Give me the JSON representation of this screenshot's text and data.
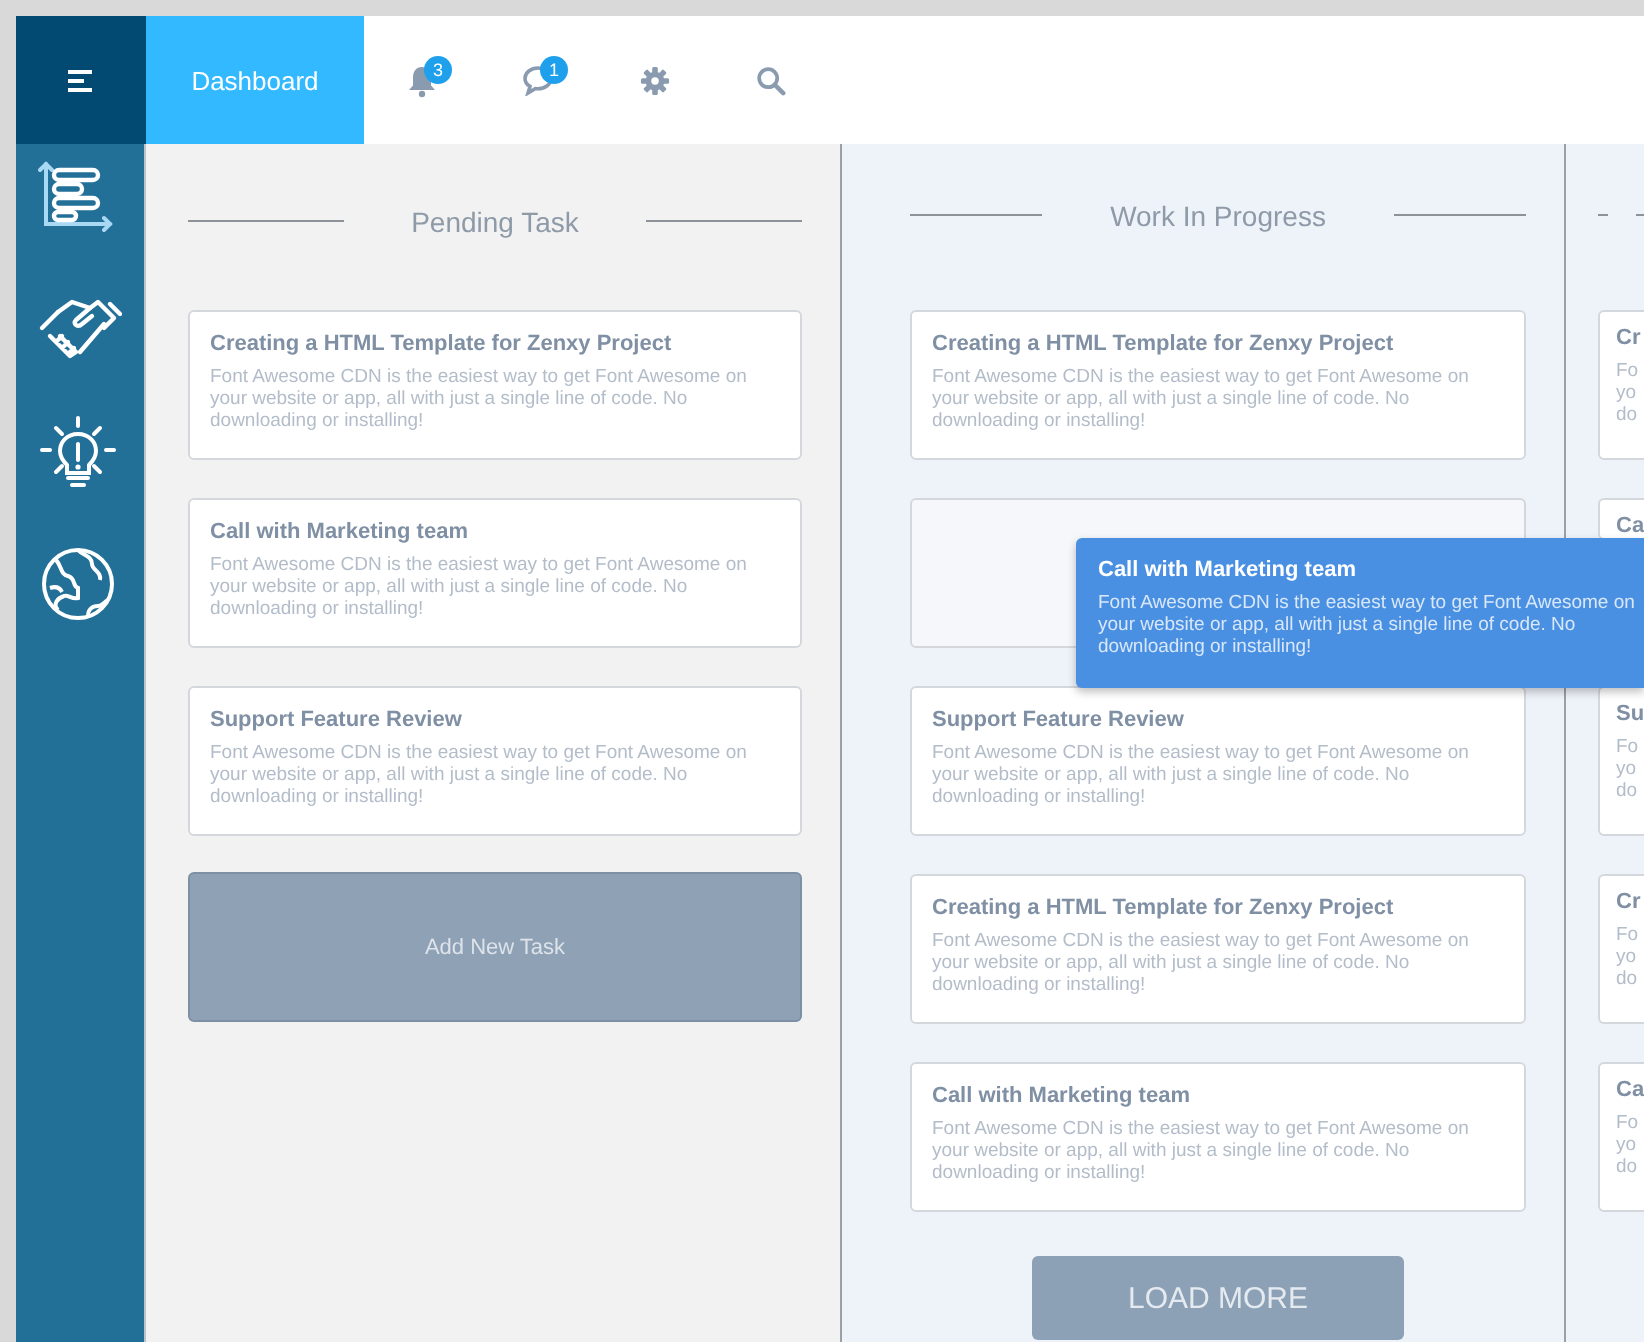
{
  "tabs": [
    {
      "label": "Dashboard",
      "selected": true
    }
  ],
  "toolbar": [
    {
      "kind": "bell",
      "badge": "3"
    },
    {
      "kind": "chat",
      "badge": "1"
    },
    {
      "kind": "gear"
    },
    {
      "kind": "search"
    }
  ],
  "sidebar": {
    "items": [
      {
        "kind": "chart"
      },
      {
        "kind": "handshake"
      },
      {
        "kind": "idea"
      },
      {
        "kind": "globe"
      }
    ]
  },
  "columns": [
    {
      "title": "Pending Task",
      "cards": [
        {
          "title": "Creating a HTML Template for Zenxy Project",
          "text": "Font Awesome CDN is the easiest way to get Font Awesome on your website or app, all with just a single line of code. No downloading or installing!"
        },
        {
          "title": "Call with Marketing team",
          "text": "Font Awesome CDN is the easiest way to get Font Awesome on your website or app, all with just a single line of code. No downloading or installing!"
        },
        {
          "title": "Support Feature Review",
          "text": "Font Awesome CDN is the easiest way to get Font Awesome on your website or app, all with just a single line of code. No downloading or installing!"
        }
      ],
      "button": {
        "kind": "add",
        "label": "Add New Task"
      }
    },
    {
      "title": "Work In Progress",
      "cards": [
        {
          "title": "Creating a HTML Template for Zenxy Project",
          "text": "Font Awesome CDN is the easiest way to get Font Awesome on your website or app, all with just a single line of code. No downloading or installing!"
        },
        {
          "kind": "placeholder"
        },
        {
          "title": "Support Feature Review",
          "text": "Font Awesome CDN is the easiest way to get Font Awesome on your website or app, all with just a single line of code. No downloading or installing!"
        },
        {
          "title": "Creating a HTML Template for Zenxy Project",
          "text": "Font Awesome CDN is the easiest way to get Font Awesome on your website or app, all with just a single line of code. No downloading or installing!"
        },
        {
          "title": "Call with Marketing team",
          "text": "Font Awesome CDN is the easiest way to get Font Awesome on your website or app, all with just a single line of code. No downloading or installing!"
        }
      ],
      "button": {
        "kind": "load",
        "label": "LOAD MORE"
      }
    },
    {
      "cards": [
        {
          "title": "Cr",
          "text_lines": [
            "Fo",
            "yo",
            "do"
          ]
        },
        {
          "title": "Ca"
        },
        {
          "title": "Su",
          "text_lines": [
            "Fo",
            "yo",
            "do"
          ]
        },
        {
          "title": "Cr",
          "text_lines": [
            "Fo",
            "yo",
            "do"
          ]
        },
        {
          "title": "Ca",
          "text_lines": [
            "Fo",
            "yo",
            "do"
          ]
        }
      ]
    }
  ],
  "dragged_card": {
    "title": "Call with Marketing team",
    "text": "Font Awesome CDN is the easiest way to get Font Awesome on your website or app, all with just a single line of code. No downloading or installing!"
  }
}
